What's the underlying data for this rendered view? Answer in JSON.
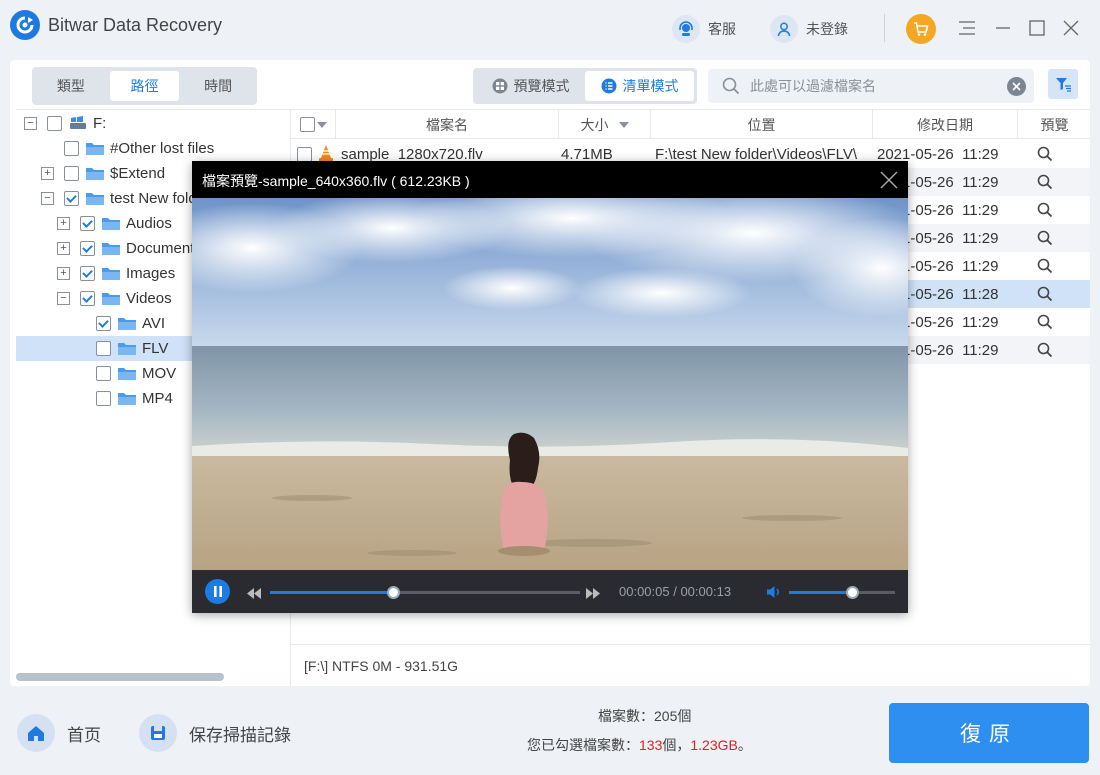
{
  "app": {
    "title": "Bitwar Data Recovery"
  },
  "header": {
    "support_label": "客服",
    "login_label": "未登錄"
  },
  "view_tabs": [
    {
      "label": "類型",
      "active": false
    },
    {
      "label": "路徑",
      "active": true
    },
    {
      "label": "時間",
      "active": false
    }
  ],
  "modes": {
    "preview_label": "預覽模式",
    "list_label": "清單模式",
    "active": "list"
  },
  "search": {
    "placeholder": "此處可以過濾檔案名"
  },
  "tree": [
    {
      "label": "F:",
      "expander": "−",
      "checked": false,
      "level": 0,
      "icon": "drive-icon"
    },
    {
      "label": "#Other lost files",
      "expander": "",
      "checked": false,
      "level": 1,
      "icon": "folder-icon"
    },
    {
      "label": "$Extend",
      "expander": "+",
      "checked": false,
      "level": 1,
      "icon": "folder-icon"
    },
    {
      "label": "test New folder",
      "expander": "−",
      "checked": true,
      "level": 1,
      "icon": "folder-icon"
    },
    {
      "label": "Audios",
      "expander": "+",
      "checked": true,
      "level": 2,
      "icon": "folder-icon"
    },
    {
      "label": "Documents",
      "expander": "+",
      "checked": true,
      "level": 2,
      "icon": "folder-icon"
    },
    {
      "label": "Images",
      "expander": "+",
      "checked": true,
      "level": 2,
      "icon": "folder-icon"
    },
    {
      "label": "Videos",
      "expander": "−",
      "checked": true,
      "level": 2,
      "icon": "folder-icon"
    },
    {
      "label": "AVI",
      "expander": "",
      "checked": true,
      "level": 3,
      "icon": "folder-icon"
    },
    {
      "label": "FLV",
      "expander": "",
      "checked": false,
      "level": 3,
      "icon": "folder-icon",
      "selected": true
    },
    {
      "label": "MOV",
      "expander": "",
      "checked": false,
      "level": 3,
      "icon": "folder-icon"
    },
    {
      "label": "MP4",
      "expander": "",
      "checked": false,
      "level": 3,
      "icon": "folder-icon"
    }
  ],
  "table": {
    "columns": {
      "name": "檔案名",
      "size": "大小",
      "location": "位置",
      "modified": "修改日期",
      "preview": "預覽"
    },
    "rows": [
      {
        "name": "sample_1280x720.flv",
        "size": "4.71MB",
        "location": "F:\\test New folder\\Videos\\FLV\\",
        "modified": "2021-05-26  11:29"
      },
      {
        "name": "",
        "size": "",
        "location": "",
        "modified": "2021-05-26  11:29"
      },
      {
        "name": "",
        "size": "",
        "location": "",
        "modified": "2021-05-26  11:29"
      },
      {
        "name": "",
        "size": "",
        "location": "",
        "modified": "2021-05-26  11:29"
      },
      {
        "name": "",
        "size": "",
        "location": "",
        "modified": "2021-05-26  11:29"
      },
      {
        "name": "",
        "size": "",
        "location": "",
        "modified": "2021-05-26  11:28",
        "selected": true
      },
      {
        "name": "",
        "size": "",
        "location": "",
        "modified": "2021-05-26  11:29"
      },
      {
        "name": "",
        "size": "",
        "location": "",
        "modified": "2021-05-26  11:29"
      }
    ]
  },
  "status_line": "[F:\\] NTFS 0M - 931.51G",
  "preview": {
    "title": "檔案預覽-sample_640x360.flv ( 612.23KB )",
    "time": "00:00:05 / 00:00:13",
    "progress": 0.4,
    "volume": 0.6
  },
  "footer": {
    "home_label": "首页",
    "save_label": "保存掃描記錄",
    "count_prefix": "檔案數：",
    "count_value": "205",
    "count_suffix": "個",
    "selected_prefix": "您已勾選檔案數：",
    "selected_count": "133",
    "selected_mid": "個，",
    "selected_size": "1.23GB",
    "selected_end": "。",
    "recover_label": "復原"
  },
  "colors": {
    "accent": "#1e7be0",
    "recover": "#2e8ff0",
    "highlight": "#e02020"
  }
}
